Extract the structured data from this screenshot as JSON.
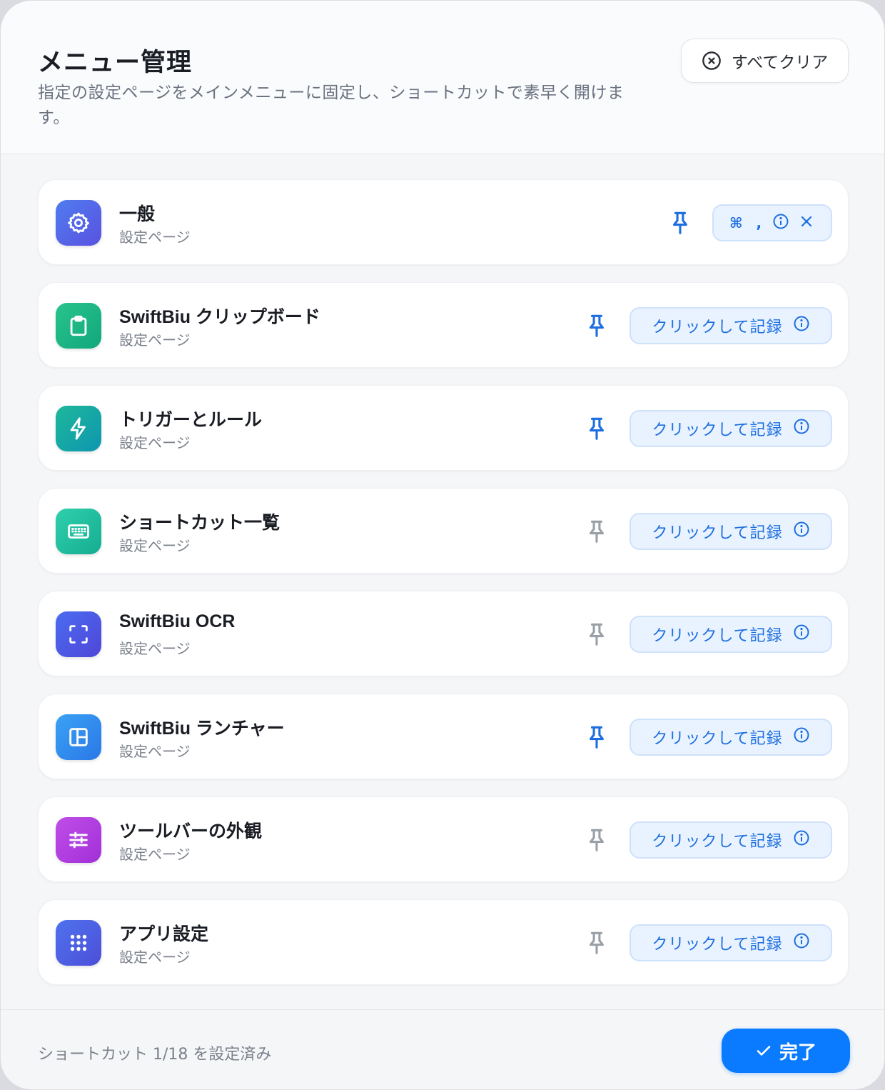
{
  "header": {
    "title": "メニュー管理",
    "subtitle": "指定の設定ページをメインメニューに固定し、ショートカットで素早く開けます。",
    "clear_all_label": "すべてクリア"
  },
  "items": [
    {
      "name": "一般",
      "subtitle": "設定ページ",
      "icon": "gear-icon",
      "color_from": "#4f7cf0",
      "color_to": "#5a52e0",
      "pinned": true,
      "shortcut": "⌘ ,",
      "record_label": ""
    },
    {
      "name": "SwiftBiu クリップボード",
      "subtitle": "設定ページ",
      "icon": "clipboard-icon",
      "color_from": "#28c48c",
      "color_to": "#12a77c",
      "pinned": true,
      "shortcut": "",
      "record_label": "クリックして記録"
    },
    {
      "name": "トリガーとルール",
      "subtitle": "設定ページ",
      "icon": "bolt-icon",
      "color_from": "#1db89a",
      "color_to": "#0e96b0",
      "pinned": true,
      "shortcut": "",
      "record_label": "クリックして記録"
    },
    {
      "name": "ショートカット一覧",
      "subtitle": "設定ページ",
      "icon": "keyboard-icon",
      "color_from": "#2fd0ac",
      "color_to": "#15ad92",
      "pinned": false,
      "shortcut": "",
      "record_label": "クリックして記録"
    },
    {
      "name": "SwiftBiu OCR",
      "subtitle": "設定ページ",
      "icon": "scan-icon",
      "color_from": "#4a6cf0",
      "color_to": "#4f46d8",
      "pinned": false,
      "shortcut": "",
      "record_label": "クリックして記録"
    },
    {
      "name": "SwiftBiu ランチャー",
      "subtitle": "設定ページ",
      "icon": "layout-icon",
      "color_from": "#3aa2f5",
      "color_to": "#2a78e6",
      "pinned": true,
      "shortcut": "",
      "record_label": "クリックして記録"
    },
    {
      "name": "ツールバーの外観",
      "subtitle": "設定ページ",
      "icon": "sliders-icon",
      "color_from": "#c04ee8",
      "color_to": "#a12fd8",
      "pinned": false,
      "shortcut": "",
      "record_label": "クリックして記録"
    },
    {
      "name": "アプリ設定",
      "subtitle": "設定ページ",
      "icon": "grid-icon",
      "color_from": "#4f72ee",
      "color_to": "#4c4fd8",
      "pinned": false,
      "shortcut": "",
      "record_label": "クリックして記録"
    }
  ],
  "colors": {
    "pinned": "#1d6fe0",
    "unpinned": "#9aa0a8",
    "accent": "#0a7bff"
  },
  "footer": {
    "status": "ショートカット 1/18 を設定済み",
    "done_label": "完了"
  }
}
